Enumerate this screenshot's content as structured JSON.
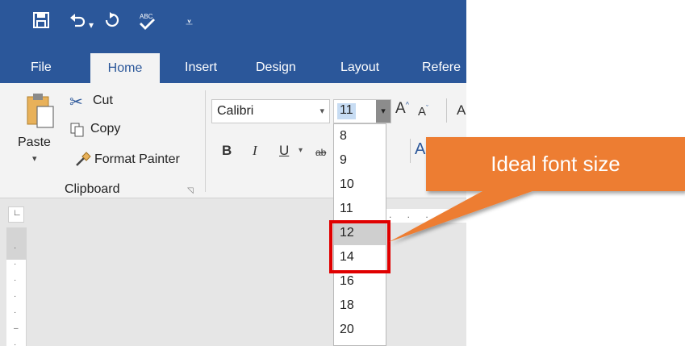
{
  "tabs": [
    {
      "label": "File"
    },
    {
      "label": "Home"
    },
    {
      "label": "Insert"
    },
    {
      "label": "Design"
    },
    {
      "label": "Layout"
    },
    {
      "label": "Refere"
    }
  ],
  "clipboard": {
    "paste": "Paste",
    "cut": "Cut",
    "copy": "Copy",
    "format_painter": "Format Painter",
    "group_label": "Clipboard"
  },
  "font": {
    "name": "Calibri",
    "size": "11",
    "bold": "B",
    "italic": "I",
    "underline": "U",
    "abc": "ab"
  },
  "font_sizes": [
    "8",
    "9",
    "10",
    "11",
    "12",
    "14",
    "16",
    "18",
    "20"
  ],
  "highlighted_size": "12",
  "annotation": {
    "text": "Ideal font size",
    "color": "#ed7d31",
    "box_color": "#e00000"
  },
  "colors": {
    "title_bar": "#2b579a",
    "ribbon": "#f3f3f3",
    "document": "#e6e6e6"
  }
}
